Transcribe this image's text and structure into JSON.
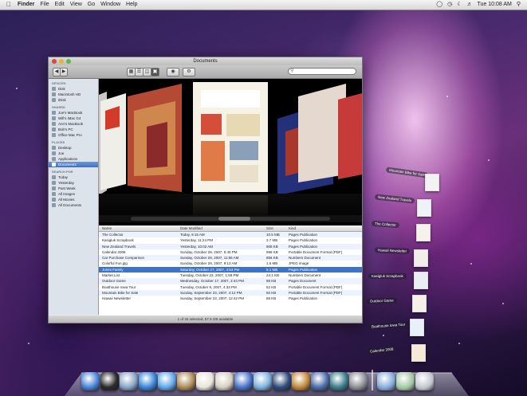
{
  "menubar": {
    "apple_icon": "apple-logo-icon",
    "menus": [
      "Finder",
      "File",
      "Edit",
      "View",
      "Go",
      "Window",
      "Help"
    ],
    "status_icons": [
      "spotlight-icon",
      "bluetooth-icon",
      "time-machine-icon",
      "wifi-icon",
      "volume-icon"
    ],
    "clock": "Tue 10:08 AM"
  },
  "window": {
    "title": "Documents",
    "search_placeholder": "",
    "sidebar": {
      "sections": [
        {
          "header": "DEVICES",
          "items": [
            "Disk",
            "Macintosh HD",
            "iDisk"
          ]
        },
        {
          "header": "SHARED",
          "items": [
            "Joe's MacBook",
            "Will's iMac G4",
            "Ann's MacBook",
            "Bob's PC",
            "Office Mac Pro"
          ]
        },
        {
          "header": "PLACES",
          "items": [
            "Desktop",
            "Joe",
            "Applications",
            "Documents"
          ]
        },
        {
          "header": "SEARCH FOR",
          "items": [
            "Today",
            "Yesterday",
            "Past Week",
            "All Images",
            "All Movies",
            "All Documents"
          ]
        }
      ],
      "selected": "Documents"
    },
    "list_headers": [
      "Name",
      "Date Modified",
      "Size",
      "Kind"
    ],
    "rows": [
      [
        "The Collector",
        "Today, 9:15 AM",
        "10.5 MB",
        "Pages Publication"
      ],
      [
        "Kasigluk Scrapbook",
        "Yesterday, 11:24 PM",
        "3.7 MB",
        "Pages Publication"
      ],
      [
        "New Zealand Travels",
        "Yesterday, 10:02 AM",
        "908 KB",
        "Pages Publication"
      ],
      [
        "Calendar 2008",
        "Sunday, October 28, 2007, 5:40 PM",
        "998 KB",
        "Portable Document Format (PDF)"
      ],
      [
        "Car Purchase Comparison",
        "Sunday, October 28, 2007, 11:56 AM",
        "856 KB",
        "Numbers Document"
      ],
      [
        "Colorful Fun.jpg",
        "Sunday, October 28, 2007, 9:13 AM",
        "1.5 MB",
        "JPEG image"
      ],
      [
        "Jones Family",
        "Saturday, October 27, 2007, 4:53 PM",
        "5.1 MB",
        "Pages Publication"
      ],
      [
        "Market List",
        "Tuesday, October 23, 2007, 1:59 PM",
        "24.1 KB",
        "Numbers Document"
      ],
      [
        "Outdoor Game",
        "Wednesday, October 17, 2007, 2:44 PM",
        "88 KB",
        "Pages Document"
      ],
      [
        "Boathouse Iowa Tour",
        "Tuesday, October 9, 2007, 4:33 PM",
        "52 KB",
        "Portable Document Format (PDF)"
      ],
      [
        "Mountain Bike for Sale",
        "Sunday, September 23, 2007, 4:12 PM",
        "92 KB",
        "Portable Document Format (PDF)"
      ],
      [
        "Hawaii Newsletter",
        "Sunday, September 23, 2007, 12:42 PM",
        "88 KB",
        "Pages Publication"
      ]
    ],
    "selected_row": 6,
    "status": "1 of 32 selected, 57.5 GB available"
  },
  "stack": {
    "items": [
      "Mountain Bike for Sale",
      "New Zealand Travels",
      "The Collector",
      "Hawaii Newsletter",
      "Kasigluk Scrapbook",
      "Outdoor Game",
      "Boathouse Iowa Tour",
      "Calendar 2008"
    ]
  },
  "dock": {
    "items": [
      "finder-icon",
      "dashboard-icon",
      "mail-icon",
      "safari-icon",
      "ichat-icon",
      "address-book-icon",
      "ical-icon",
      "preview-icon",
      "itunes-icon",
      "iphoto-icon",
      "imovie-icon",
      "garageband-icon",
      "spaces-icon",
      "time-machine-icon",
      "system-preferences-icon"
    ],
    "right_items": [
      "documents-stack-icon",
      "downloads-stack-icon",
      "trash-icon"
    ]
  },
  "colors": {
    "selection": "#3d74c9",
    "sidebar": "#dde3ea",
    "accent": "#6f98d6"
  }
}
